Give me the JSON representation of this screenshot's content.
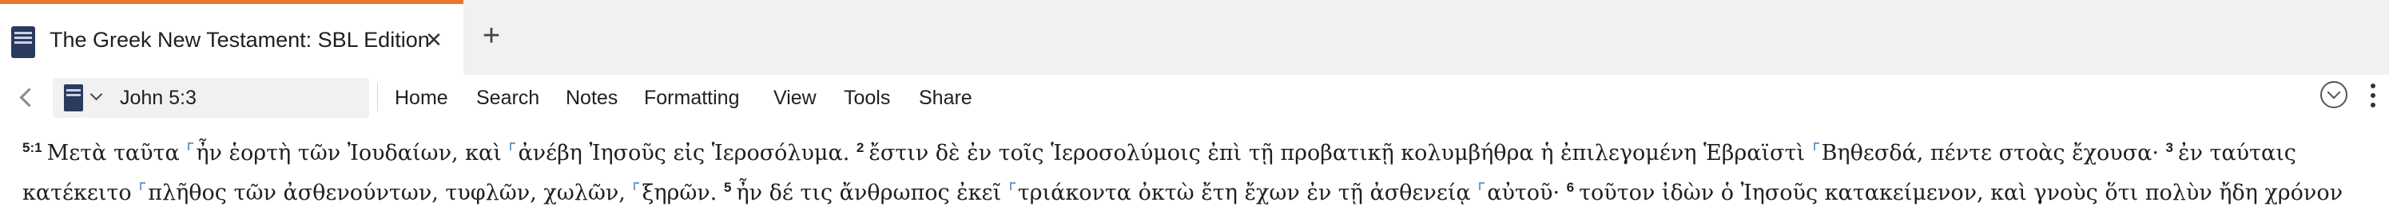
{
  "tab": {
    "title": "The Greek New Testament: SBL Edition",
    "close_glyph": "✕",
    "new_tab_glyph": "+",
    "accent_color": "#e8772e"
  },
  "toolbar": {
    "reference": "John 5:3",
    "menu": [
      "Home",
      "Search",
      "Notes",
      "Formatting",
      "View",
      "Tools",
      "Share"
    ]
  },
  "text": {
    "verses": [
      {
        "num": "5:1",
        "segments": [
          "Μετὰ ταῦτα ",
          "ἦν ἑορτὴ τῶν Ἰουδαίων, καὶ ",
          "ἀνέβη Ἰησοῦς εἰς Ἱεροσόλυμα. "
        ]
      },
      {
        "num": "2",
        "segments": [
          "ἔστιν δὲ ἐν τοῖς Ἱεροσολύμοις ἐπὶ τῇ προβατικῇ κολυμβήθρα ἡ ἐπιλεγομένη Ἑβραϊστὶ ",
          "Βηθεσδά, πέντε στοὰς ἔχουσα· "
        ]
      },
      {
        "num": "3",
        "segments": [
          "ἐν ταύταις"
        ]
      },
      {
        "num": "",
        "segments": [
          "κατέκειτο ",
          "πλῆθος τῶν ἀσθενούντων, τυφλῶν, χωλῶν, ",
          "ξηρῶν. "
        ]
      },
      {
        "num": "5",
        "segments": [
          "ἦν δέ τις ἄνθρωπος ἐκεῖ ",
          "τριάκοντα ὀκτὼ ἔτη ἔχων ἐν τῇ ἀσθενείᾳ ",
          "αὐτοῦ· "
        ]
      },
      {
        "num": "6",
        "segments": [
          "τοῦτον ἰδὼν ὁ Ἰησοῦς κατακείμενον, καὶ γνοὺς ὅτι πολὺν ἤδη χρόνον"
        ]
      }
    ]
  }
}
